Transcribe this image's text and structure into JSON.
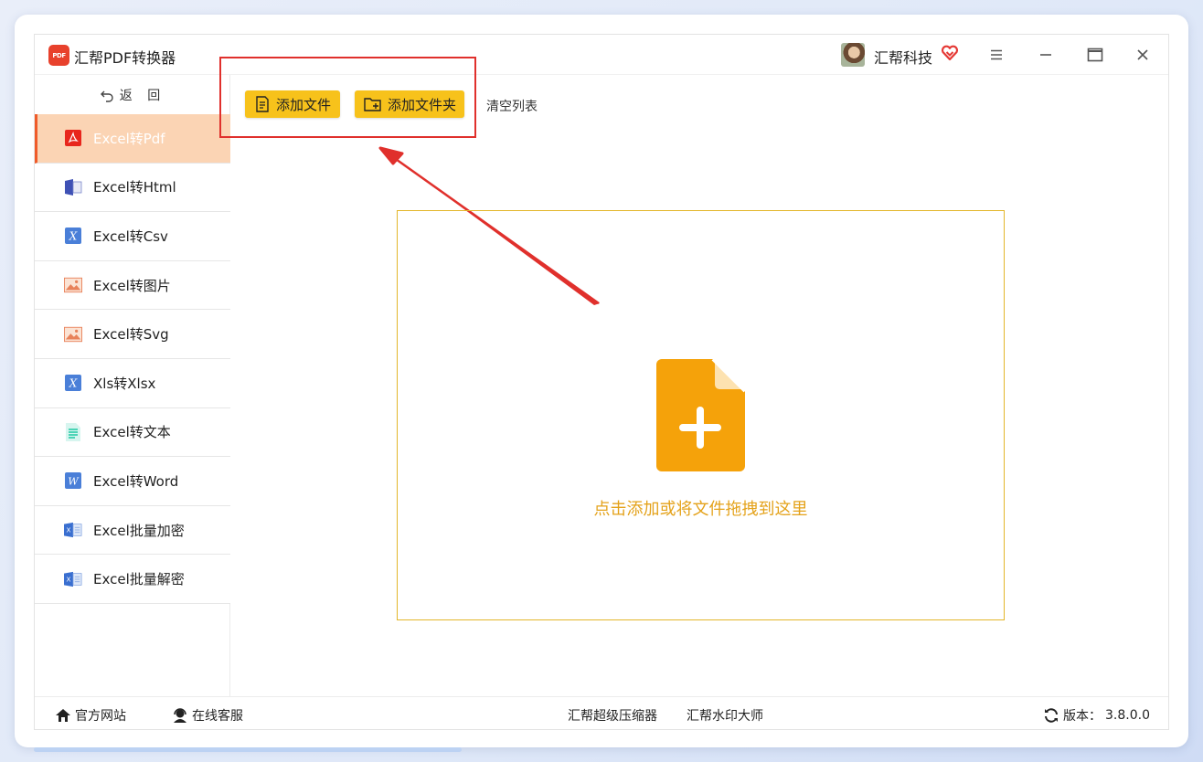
{
  "app": {
    "title": "汇帮PDF转换器",
    "logo_text": "PDF",
    "brand": "汇帮科技"
  },
  "sidebar": {
    "back_label": "返 回",
    "items": [
      {
        "label": "Excel转Pdf",
        "icon": "pdf-icon",
        "active": true
      },
      {
        "label": "Excel转Html",
        "icon": "html-icon"
      },
      {
        "label": "Excel转Csv",
        "icon": "csv-icon"
      },
      {
        "label": "Excel转图片",
        "icon": "image-icon"
      },
      {
        "label": "Excel转Svg",
        "icon": "svg-image-icon"
      },
      {
        "label": "Xls转Xlsx",
        "icon": "xlsx-icon"
      },
      {
        "label": "Excel转文本",
        "icon": "text-icon"
      },
      {
        "label": "Excel转Word",
        "icon": "word-icon"
      },
      {
        "label": "Excel批量加密",
        "icon": "excel-encrypt-icon"
      },
      {
        "label": "Excel批量解密",
        "icon": "excel-decrypt-icon"
      }
    ]
  },
  "toolbar": {
    "add_file": "添加文件",
    "add_folder": "添加文件夹",
    "clear_list": "清空列表"
  },
  "dropzone": {
    "text": "点击添加或将文件拖拽到这里"
  },
  "footer": {
    "site": "官方网站",
    "service": "在线客服",
    "compress": "汇帮超级压缩器",
    "watermark": "汇帮水印大师",
    "version_label": "版本：",
    "version": "3.8.0.0"
  },
  "colors": {
    "accent": "#f7c21b",
    "active_bg": "#fbd4b4",
    "drop_icon": "#f5a20a",
    "annotation": "#e0302c"
  }
}
